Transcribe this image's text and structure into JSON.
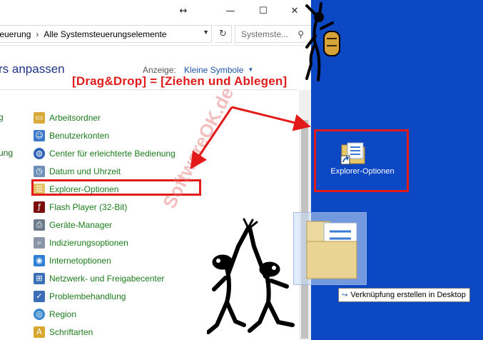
{
  "window": {
    "controls": {
      "minimize": "—",
      "maximize": "☐",
      "close": "✕",
      "resize_cursor": "↔"
    }
  },
  "address": {
    "crumb_1": "teuerung",
    "crumb_2": "Alle Systemsteuerungselemente",
    "search_placeholder": "Systemste..."
  },
  "header": {
    "title_fragment": "rs anpassen",
    "view_label": "Anzeige:",
    "view_value": "Kleine Symbole"
  },
  "left_fragments": [
    "g",
    "ung"
  ],
  "items": [
    {
      "label": "Arbeitsordner",
      "icon": "folder-sync-icon",
      "color": "#d9a93b"
    },
    {
      "label": "Benutzerkonten",
      "icon": "users-icon",
      "color": "#3d7ac9"
    },
    {
      "label": "Center für erleichterte Bedienung",
      "icon": "accessibility-icon",
      "color": "#2d62b8"
    },
    {
      "label": "Datum und Uhrzeit",
      "icon": "clock-icon",
      "color": "#6e8fb8"
    },
    {
      "label": "Explorer-Optionen",
      "icon": "folder-options-icon",
      "color": "#e1c066"
    },
    {
      "label": "Flash Player (32-Bit)",
      "icon": "flash-icon",
      "color": "#7a0c0c"
    },
    {
      "label": "Geräte-Manager",
      "icon": "device-manager-icon",
      "color": "#6b7a8a"
    },
    {
      "label": "Indizierungsoptionen",
      "icon": "indexing-icon",
      "color": "#8a96a8"
    },
    {
      "label": "Internetoptionen",
      "icon": "internet-icon",
      "color": "#2f7fd6"
    },
    {
      "label": "Netzwerk- und Freigabecenter",
      "icon": "network-icon",
      "color": "#3b6fb8"
    },
    {
      "label": "Problembehandlung",
      "icon": "troubleshoot-icon",
      "color": "#3c6db5"
    },
    {
      "label": "Region",
      "icon": "globe-icon",
      "color": "#3a8ad0"
    },
    {
      "label": "Schriftarten",
      "icon": "fonts-icon",
      "color": "#d8a730"
    }
  ],
  "annotation": {
    "drag_drop_text": "[Drag&Drop] = [Ziehen und Ablegen]",
    "watermark": "SoftwareOK.de",
    "accent_color": "#e31a1a"
  },
  "desktop": {
    "background": "#0c47c4",
    "shortcut_label": "Explorer-Optionen",
    "tooltip_text": "Verknüpfung erstellen in Desktop"
  }
}
